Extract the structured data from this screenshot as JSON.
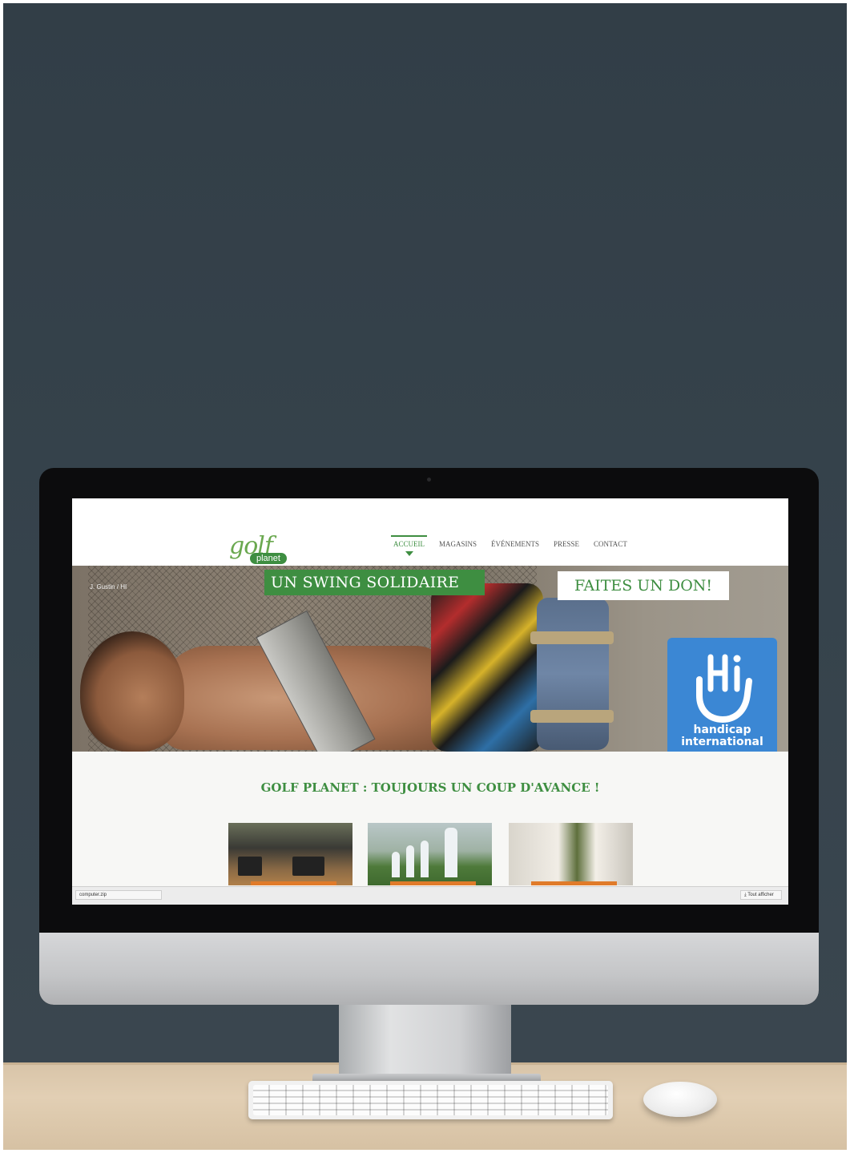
{
  "site": {
    "logo_word": "golf",
    "logo_sub": "planet",
    "nav": [
      {
        "label": "ACCUEIL",
        "active": true
      },
      {
        "label": "MAGASINS",
        "active": false
      },
      {
        "label": "ÉVÉNEMENTS",
        "active": false
      },
      {
        "label": "PRESSE",
        "active": false
      },
      {
        "label": "CONTACT",
        "active": false
      }
    ],
    "hero": {
      "credit": "J. Gustin / HI",
      "headline": "UN SWING SOLIDAIRE",
      "donate_label": "FAITES UN DON!",
      "badge_line1": "handicap",
      "badge_line2": "international",
      "badge_accent": "#3b87d4"
    },
    "section_title": "GOLF PLANET : TOUJOURS UN COUP D'AVANCE !",
    "brand_green": "#3e8e41",
    "accent_orange": "#e07b2a"
  },
  "browser": {
    "download_file": "computer.zip",
    "show_all_label": "Tout afficher"
  }
}
